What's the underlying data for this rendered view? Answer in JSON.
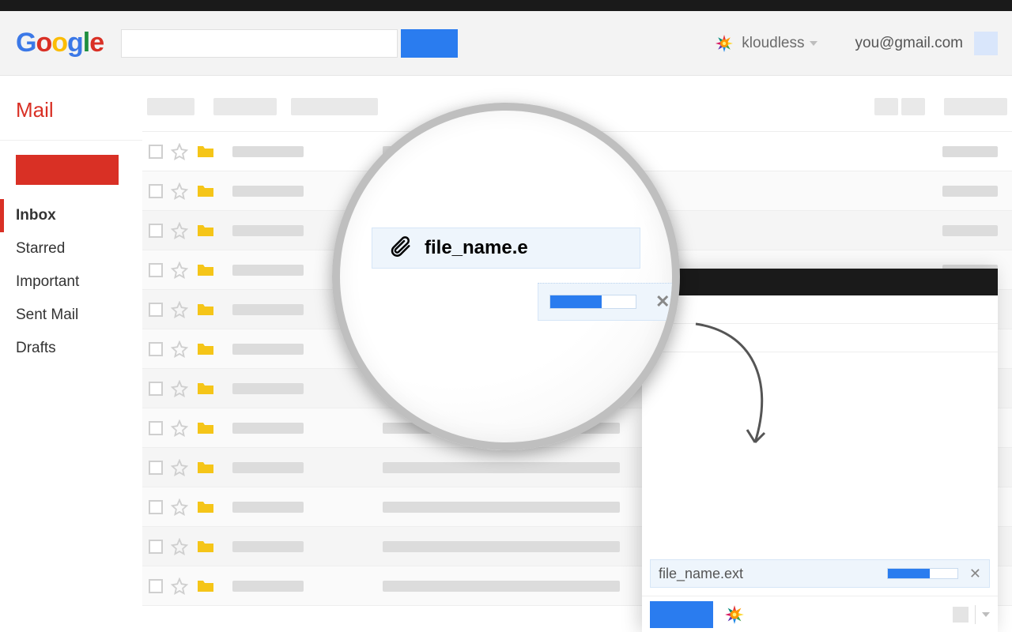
{
  "header": {
    "brand_letters": [
      "G",
      "o",
      "o",
      "g",
      "l",
      "e"
    ],
    "kloudless_label": "kloudless",
    "user_email": "you@gmail.com"
  },
  "sidebar": {
    "title": "Mail",
    "folders": [
      "Inbox",
      "Starred",
      "Important",
      "Sent Mail",
      "Drafts"
    ],
    "active_index": 0
  },
  "lens": {
    "file_label": "file_name.e",
    "progress_pct": 60
  },
  "compose": {
    "attachment_name": "file_name.ext",
    "progress_pct": 60
  },
  "mail_rows": 12,
  "colors": {
    "accent_red": "#d93025",
    "accent_blue": "#2a7cef",
    "folder_yellow": "#f5c518"
  }
}
